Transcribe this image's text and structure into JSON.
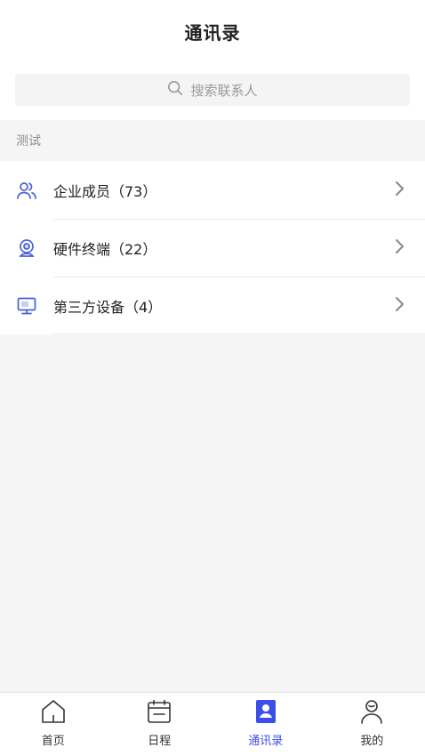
{
  "header": {
    "title": "通讯录"
  },
  "search": {
    "placeholder": "搜索联系人"
  },
  "section": {
    "label": "测试"
  },
  "contacts": [
    {
      "label": "企业成员（73）",
      "icon": "people-icon"
    },
    {
      "label": "硬件终端（22）",
      "icon": "camera-device-icon"
    },
    {
      "label": "第三方设备（4）",
      "icon": "monitor-icon"
    }
  ],
  "nav": [
    {
      "label": "首页",
      "icon": "home-icon"
    },
    {
      "label": "日程",
      "icon": "calendar-icon"
    },
    {
      "label": "通讯录",
      "icon": "contacts-icon",
      "active": true
    },
    {
      "label": "我的",
      "icon": "profile-icon"
    }
  ],
  "colors": {
    "accent": "#3c4ee8",
    "icon_blue": "#4a5fd6",
    "background": "#f5f5f5"
  }
}
